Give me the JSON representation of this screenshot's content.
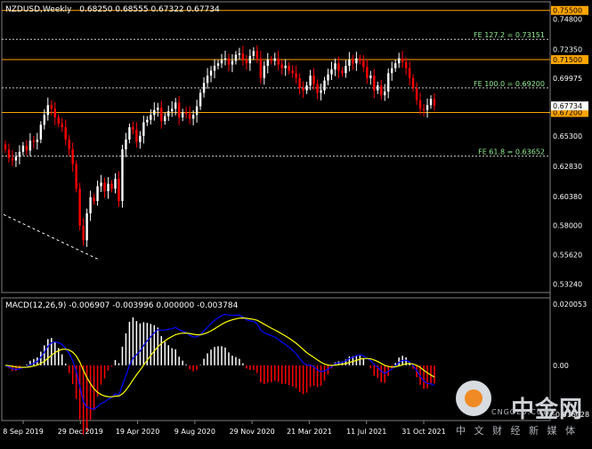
{
  "chart_header": {
    "symbol_tf": "NZDUSD,Weekly",
    "ohlc": "0.68250 0.68555 0.67322 0.67734"
  },
  "macd_header": {
    "label": "MACD(12,26,9) -0.006907 -0.003996 0.000000 -0.003784"
  },
  "watermark": {
    "brand_cn": "中金网",
    "brand_en": "CNGOLD.COM",
    "footer_cn": "中 文 财 经 新 媒 体"
  },
  "colors": {
    "background": "#000000",
    "bull": "#ffffff",
    "bear": "#ff0000",
    "level_line": "#ffa500",
    "fib_line": "#cccccc",
    "fib_text": "#90ee90",
    "macd_line": "#0000ff",
    "signal_line": "#ffff00"
  },
  "chart_data": [
    {
      "type": "candlestick",
      "title": "NZDUSD,Weekly",
      "y_axis_ticks": [
        "0.74800",
        "0.72350",
        "0.69975",
        "0.67734",
        "0.65300",
        "0.62830",
        "0.60380",
        "0.58000",
        "0.55620",
        "0.53240"
      ],
      "ylim": [
        0.527,
        0.7606
      ],
      "x_axis_labels": [
        "8 Sep 2019",
        "29 Dec 2019",
        "19 Apr 2020",
        "9 Aug 2020",
        "29 Nov 2020",
        "21 Mar 2021",
        "11 Jul 2021",
        "31 Oct 2021"
      ],
      "horizontal_levels": [
        {
          "label": "0.75500",
          "value": 0.755
        },
        {
          "label": "0.71500",
          "value": 0.715
        },
        {
          "label": "0.67200",
          "value": 0.672
        }
      ],
      "fib_levels": [
        {
          "label": "FE 127.2 = 0.73151",
          "value": 0.73151
        },
        {
          "label": "FE 100.0 = 0.69200",
          "value": 0.692
        },
        {
          "label": "FE 61.8 = 0.63652",
          "value": 0.63652
        }
      ],
      "current_price": "0.67734",
      "current_price_value": 0.67734,
      "closes": [
        0.642,
        0.635,
        0.633,
        0.636,
        0.64,
        0.645,
        0.641,
        0.649,
        0.648,
        0.65,
        0.662,
        0.67,
        0.678,
        0.675,
        0.668,
        0.663,
        0.66,
        0.65,
        0.642,
        0.63,
        0.61,
        0.58,
        0.568,
        0.59,
        0.603,
        0.6,
        0.612,
        0.615,
        0.608,
        0.614,
        0.61,
        0.618,
        0.6,
        0.642,
        0.65,
        0.66,
        0.658,
        0.648,
        0.653,
        0.664,
        0.666,
        0.67,
        0.674,
        0.676,
        0.665,
        0.669,
        0.673,
        0.675,
        0.68,
        0.668,
        0.672,
        0.671,
        0.667,
        0.67,
        0.677,
        0.688,
        0.696,
        0.702,
        0.706,
        0.71,
        0.712,
        0.715,
        0.716,
        0.711,
        0.714,
        0.719,
        0.72,
        0.715,
        0.712,
        0.718,
        0.722,
        0.716,
        0.7,
        0.71,
        0.715,
        0.714,
        0.716,
        0.711,
        0.708,
        0.71,
        0.706,
        0.704,
        0.7,
        0.692,
        0.69,
        0.694,
        0.702,
        0.695,
        0.688,
        0.69,
        0.698,
        0.703,
        0.707,
        0.712,
        0.706,
        0.704,
        0.71,
        0.715,
        0.712,
        0.716,
        0.714,
        0.709,
        0.7,
        0.702,
        0.69,
        0.694,
        0.686,
        0.689,
        0.704,
        0.708,
        0.712,
        0.716,
        0.713,
        0.708,
        0.7,
        0.692,
        0.682,
        0.675,
        0.674,
        0.678,
        0.683,
        0.67734
      ]
    },
    {
      "type": "macd",
      "title": "MACD(12,26,9)",
      "y_axis_ticks": [
        "0.020053",
        "0.00",
        "-0.016028"
      ],
      "ylim": [
        -0.0175,
        0.0215
      ],
      "values": {
        "macd": -0.006907,
        "signal": -0.003996,
        "zero": 0.0,
        "histogram": -0.003784
      }
    }
  ]
}
